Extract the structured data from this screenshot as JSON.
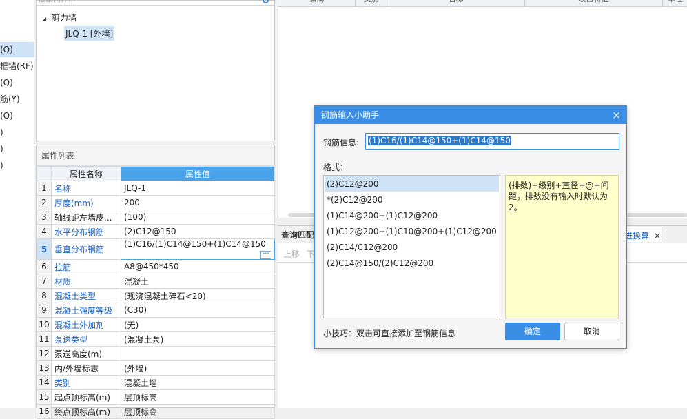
{
  "left_strip": {
    "items": [
      "(Q)",
      "框墙(RF)",
      "(Q)",
      "筋(Y)",
      "(Q)",
      ")",
      ")",
      ")"
    ]
  },
  "tree": {
    "search_placeholder": "搜索构件...",
    "group_label": "剪力墙",
    "expand_glyph": "◢",
    "child_label": "JLQ-1 [外墙]"
  },
  "props": {
    "panel_title": "属性列表",
    "col_name": "属性名称",
    "col_value": "属性值",
    "rows": [
      {
        "n": "1",
        "name": "名称",
        "value": "JLQ-1"
      },
      {
        "n": "2",
        "name": "厚度(mm)",
        "value": "200"
      },
      {
        "n": "3",
        "name": "轴线距左墙皮...",
        "value": "(100)"
      },
      {
        "n": "4",
        "name": "水平分布钢筋",
        "value": "(2)C12@150"
      },
      {
        "n": "5",
        "name": "垂直分布钢筋",
        "value": "(1)C16/(1)C14@150+(1)C14@150"
      },
      {
        "n": "6",
        "name": "拉筋",
        "value": "A8@450*450"
      },
      {
        "n": "7",
        "name": "材质",
        "value": "混凝土"
      },
      {
        "n": "8",
        "name": "混凝土类型",
        "value": "(现浇混凝土碎石<20)"
      },
      {
        "n": "9",
        "name": "混凝土强度等级",
        "value": "(C30)"
      },
      {
        "n": "10",
        "name": "混凝土外加剂",
        "value": "(无)"
      },
      {
        "n": "11",
        "name": "泵送类型",
        "value": "(混凝土泵)"
      },
      {
        "n": "12",
        "name": "泵送高度(m)",
        "value": ""
      },
      {
        "n": "13",
        "name": "内/外墙标志",
        "value": "(外墙)"
      },
      {
        "n": "14",
        "name": "类别",
        "value": "混凝土墙"
      },
      {
        "n": "15",
        "name": "起点顶标高(m)",
        "value": "层顶标高"
      },
      {
        "n": "16",
        "name": "终点顶标高(m)",
        "value": "层顶标高"
      }
    ],
    "more_button": "···"
  },
  "right": {
    "header_cols": [
      "编码",
      "类别",
      "名称",
      "项目特征",
      "单位"
    ],
    "tab_query": "查询匹配",
    "tab_convert": "进换算",
    "tab_close": "×",
    "toolbar_up": "上移",
    "toolbar_down": "下"
  },
  "dialog": {
    "title": "钢筋输入小助手",
    "close": "×",
    "info_label": "钢筋信息:",
    "info_value": "(1)C16/(1)C14@150+(1)C14@150",
    "format_label": "格式：",
    "formats": [
      "(2)C12@200",
      "*(2)C12@200",
      "(1)C14@200+(1)C12@200",
      "(1)C12@200+(1)C10@200+(1)C12@200",
      "(2)C14/C12@200",
      "(2)C14@150/(2)C12@200"
    ],
    "help_text": "(排数)+级别+直径+@+间距，排数没有输入时默认为2。",
    "tip": "小技巧：双击可直接添加至钢筋信息",
    "ok": "确定",
    "cancel": "取消"
  }
}
